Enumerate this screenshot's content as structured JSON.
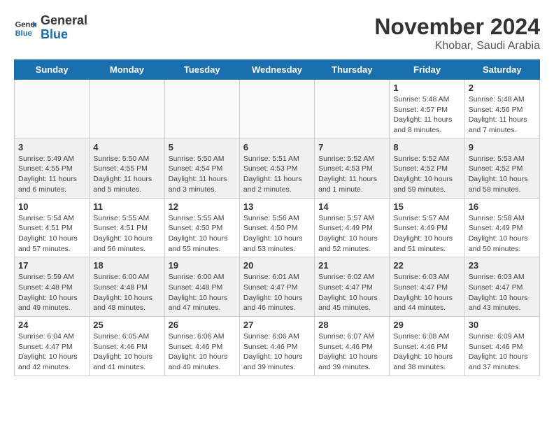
{
  "header": {
    "logo_line1": "General",
    "logo_line2": "Blue",
    "month_title": "November 2024",
    "location": "Khobar, Saudi Arabia"
  },
  "weekdays": [
    "Sunday",
    "Monday",
    "Tuesday",
    "Wednesday",
    "Thursday",
    "Friday",
    "Saturday"
  ],
  "weeks": [
    [
      {
        "day": "",
        "info": ""
      },
      {
        "day": "",
        "info": ""
      },
      {
        "day": "",
        "info": ""
      },
      {
        "day": "",
        "info": ""
      },
      {
        "day": "",
        "info": ""
      },
      {
        "day": "1",
        "info": "Sunrise: 5:48 AM\nSunset: 4:57 PM\nDaylight: 11 hours\nand 8 minutes."
      },
      {
        "day": "2",
        "info": "Sunrise: 5:48 AM\nSunset: 4:56 PM\nDaylight: 11 hours\nand 7 minutes."
      }
    ],
    [
      {
        "day": "3",
        "info": "Sunrise: 5:49 AM\nSunset: 4:55 PM\nDaylight: 11 hours\nand 6 minutes."
      },
      {
        "day": "4",
        "info": "Sunrise: 5:50 AM\nSunset: 4:55 PM\nDaylight: 11 hours\nand 5 minutes."
      },
      {
        "day": "5",
        "info": "Sunrise: 5:50 AM\nSunset: 4:54 PM\nDaylight: 11 hours\nand 3 minutes."
      },
      {
        "day": "6",
        "info": "Sunrise: 5:51 AM\nSunset: 4:53 PM\nDaylight: 11 hours\nand 2 minutes."
      },
      {
        "day": "7",
        "info": "Sunrise: 5:52 AM\nSunset: 4:53 PM\nDaylight: 11 hours\nand 1 minute."
      },
      {
        "day": "8",
        "info": "Sunrise: 5:52 AM\nSunset: 4:52 PM\nDaylight: 10 hours\nand 59 minutes."
      },
      {
        "day": "9",
        "info": "Sunrise: 5:53 AM\nSunset: 4:52 PM\nDaylight: 10 hours\nand 58 minutes."
      }
    ],
    [
      {
        "day": "10",
        "info": "Sunrise: 5:54 AM\nSunset: 4:51 PM\nDaylight: 10 hours\nand 57 minutes."
      },
      {
        "day": "11",
        "info": "Sunrise: 5:55 AM\nSunset: 4:51 PM\nDaylight: 10 hours\nand 56 minutes."
      },
      {
        "day": "12",
        "info": "Sunrise: 5:55 AM\nSunset: 4:50 PM\nDaylight: 10 hours\nand 55 minutes."
      },
      {
        "day": "13",
        "info": "Sunrise: 5:56 AM\nSunset: 4:50 PM\nDaylight: 10 hours\nand 53 minutes."
      },
      {
        "day": "14",
        "info": "Sunrise: 5:57 AM\nSunset: 4:49 PM\nDaylight: 10 hours\nand 52 minutes."
      },
      {
        "day": "15",
        "info": "Sunrise: 5:57 AM\nSunset: 4:49 PM\nDaylight: 10 hours\nand 51 minutes."
      },
      {
        "day": "16",
        "info": "Sunrise: 5:58 AM\nSunset: 4:49 PM\nDaylight: 10 hours\nand 50 minutes."
      }
    ],
    [
      {
        "day": "17",
        "info": "Sunrise: 5:59 AM\nSunset: 4:48 PM\nDaylight: 10 hours\nand 49 minutes."
      },
      {
        "day": "18",
        "info": "Sunrise: 6:00 AM\nSunset: 4:48 PM\nDaylight: 10 hours\nand 48 minutes."
      },
      {
        "day": "19",
        "info": "Sunrise: 6:00 AM\nSunset: 4:48 PM\nDaylight: 10 hours\nand 47 minutes."
      },
      {
        "day": "20",
        "info": "Sunrise: 6:01 AM\nSunset: 4:47 PM\nDaylight: 10 hours\nand 46 minutes."
      },
      {
        "day": "21",
        "info": "Sunrise: 6:02 AM\nSunset: 4:47 PM\nDaylight: 10 hours\nand 45 minutes."
      },
      {
        "day": "22",
        "info": "Sunrise: 6:03 AM\nSunset: 4:47 PM\nDaylight: 10 hours\nand 44 minutes."
      },
      {
        "day": "23",
        "info": "Sunrise: 6:03 AM\nSunset: 4:47 PM\nDaylight: 10 hours\nand 43 minutes."
      }
    ],
    [
      {
        "day": "24",
        "info": "Sunrise: 6:04 AM\nSunset: 4:47 PM\nDaylight: 10 hours\nand 42 minutes."
      },
      {
        "day": "25",
        "info": "Sunrise: 6:05 AM\nSunset: 4:46 PM\nDaylight: 10 hours\nand 41 minutes."
      },
      {
        "day": "26",
        "info": "Sunrise: 6:06 AM\nSunset: 4:46 PM\nDaylight: 10 hours\nand 40 minutes."
      },
      {
        "day": "27",
        "info": "Sunrise: 6:06 AM\nSunset: 4:46 PM\nDaylight: 10 hours\nand 39 minutes."
      },
      {
        "day": "28",
        "info": "Sunrise: 6:07 AM\nSunset: 4:46 PM\nDaylight: 10 hours\nand 39 minutes."
      },
      {
        "day": "29",
        "info": "Sunrise: 6:08 AM\nSunset: 4:46 PM\nDaylight: 10 hours\nand 38 minutes."
      },
      {
        "day": "30",
        "info": "Sunrise: 6:09 AM\nSunset: 4:46 PM\nDaylight: 10 hours\nand 37 minutes."
      }
    ]
  ]
}
